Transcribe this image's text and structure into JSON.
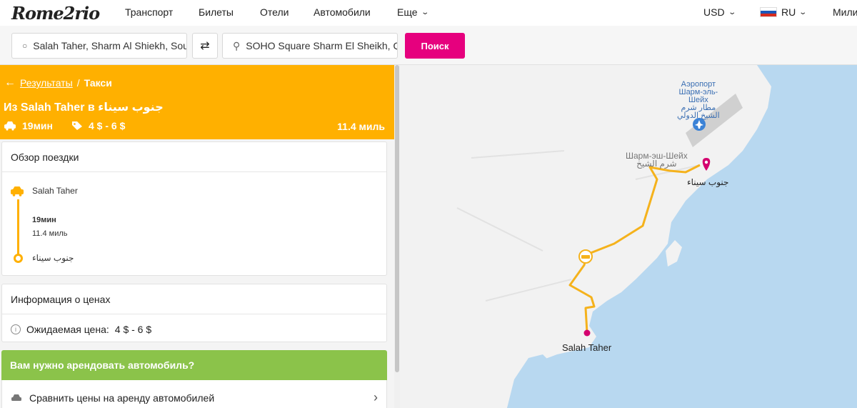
{
  "brand": {
    "logo": "Rome2rio"
  },
  "nav": {
    "transport": "Транспорт",
    "tickets": "Билеты",
    "hotels": "Отели",
    "cars": "Автомобили",
    "more": "Еще",
    "currency": "USD",
    "lang": "RU",
    "trips": "Мили"
  },
  "search": {
    "from_value": "Salah Taher, Sharm Al Shiekh, South Sinai",
    "to_value": "SOHO Square Sharm El Sheikh, Qesm Sharm",
    "button": "Поиск"
  },
  "header": {
    "back_link": "Результаты",
    "separator": "/",
    "mode": "Такси",
    "title": "Из Salah Taher в جنوب سيناء",
    "duration": "19мин",
    "price": "4 $ - 6 $",
    "distance": "11.4 миль"
  },
  "overview": {
    "title": "Обзор поездки",
    "start": "Salah Taher",
    "duration": "19мин",
    "distance": "11.4 миль",
    "end": "جنوب سيناء"
  },
  "pricing": {
    "title": "Информация о ценах",
    "label": "Ожидаемая цена:",
    "value": "4 $ - 6 $"
  },
  "rental": {
    "title": "Вам нужно арендовать автомобиль?",
    "compare": "Сравнить цены на аренду автомобилей"
  },
  "map": {
    "airport_ru": "Аэропорт",
    "airport_ru2": "Шарм-эль-",
    "airport_ru3": "Шейх",
    "airport_ar": "مطار شرم",
    "airport_ar2": "الشيخ الدولي",
    "city_ru": "Шарм-эш-Шейх",
    "city_ar": "شرم الشيخ",
    "dest_label": "جنوب سيناء",
    "origin_label": "Salah Taher",
    "colors": {
      "sea": "#b8d8f0",
      "land": "#f2f2f2",
      "route": "#f5b21c",
      "pin": "#d4006f"
    }
  }
}
